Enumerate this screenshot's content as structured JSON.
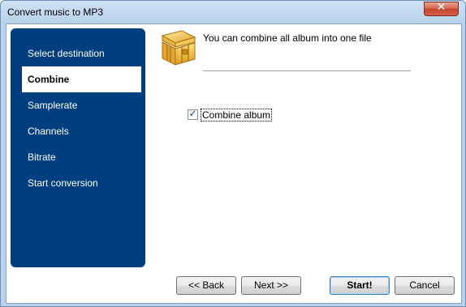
{
  "window": {
    "title": "Convert music to MP3",
    "close_glyph": "✕"
  },
  "sidebar": {
    "items": [
      {
        "label": "Select destination",
        "active": false
      },
      {
        "label": "Combine",
        "active": true
      },
      {
        "label": "Samplerate",
        "active": false
      },
      {
        "label": "Channels",
        "active": false
      },
      {
        "label": "Bitrate",
        "active": false
      },
      {
        "label": "Start conversion",
        "active": false
      }
    ]
  },
  "main": {
    "icon": "treasure-chest-icon",
    "heading": "You can combine all album into one file",
    "checkbox": {
      "label": "Combine album",
      "checked": true,
      "glyph": "✓"
    }
  },
  "buttons": {
    "back": "<< Back",
    "next": "Next >>",
    "start": "Start!",
    "cancel": "Cancel"
  },
  "colors": {
    "sidebar_bg": "#003f7f",
    "accent": "#3c7fb1"
  }
}
